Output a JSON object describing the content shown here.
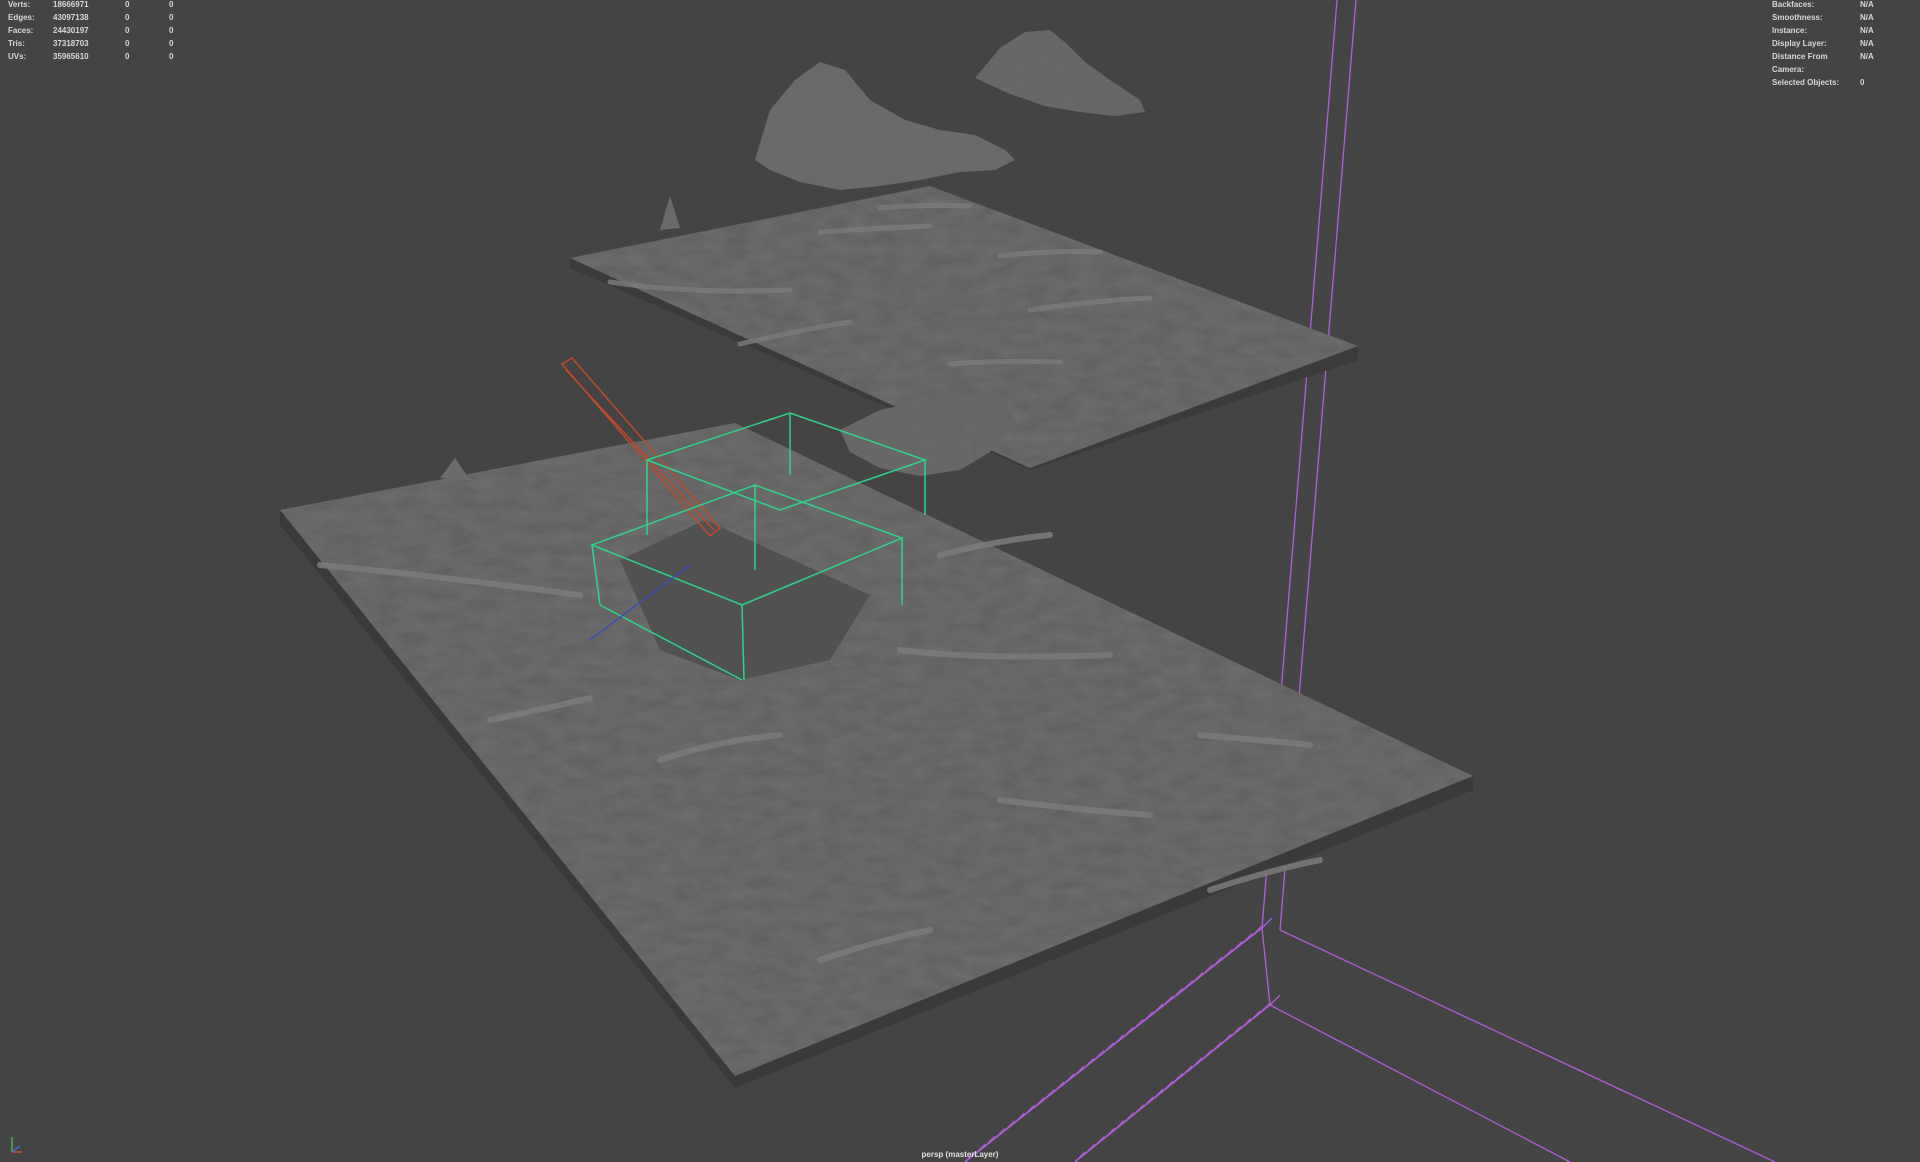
{
  "hud_stats": {
    "rows": [
      {
        "label": "Verts:",
        "total": "18666971",
        "selected": "0",
        "component": "0"
      },
      {
        "label": "Edges:",
        "total": "43097138",
        "selected": "0",
        "component": "0"
      },
      {
        "label": "Faces:",
        "total": "24430197",
        "selected": "0",
        "component": "0"
      },
      {
        "label": "Tris:",
        "total": "37318703",
        "selected": "0",
        "component": "0"
      },
      {
        "label": "UVs:",
        "total": "35965610",
        "selected": "0",
        "component": "0"
      }
    ]
  },
  "hud_info": {
    "rows": [
      {
        "label": "Backfaces:",
        "value": "N/A"
      },
      {
        "label": "Smoothness:",
        "value": "N/A"
      },
      {
        "label": "Instance:",
        "value": "N/A"
      },
      {
        "label": "Display Layer:",
        "value": "N/A"
      },
      {
        "label": "Distance From Camera:",
        "value": "N/A"
      },
      {
        "label": "Selected Objects:",
        "value": "0"
      }
    ]
  },
  "camera_label": "persp (masterLayer)",
  "colors": {
    "background": "#444444",
    "grid": "#b15cd8",
    "bounding_box": "#2fd38a",
    "camera_object": "#c24a2a",
    "terrain_top": "#5f5f5f",
    "terrain_side": "#3d3d3d"
  },
  "axis_gizmo": {
    "icon": "xyz-axis-icon"
  }
}
